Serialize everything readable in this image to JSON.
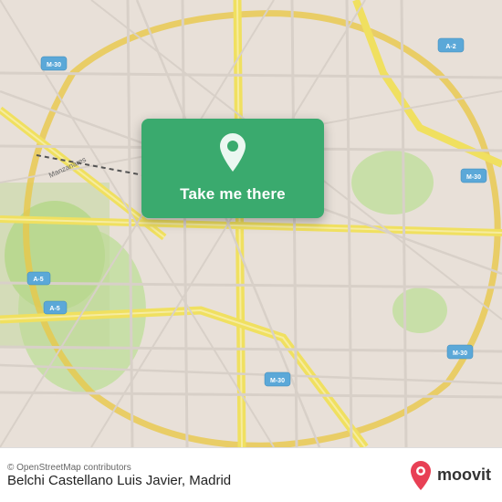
{
  "map": {
    "provider": "OpenStreetMap",
    "copyright": "© OpenStreetMap contributors"
  },
  "card": {
    "button_label": "Take me there"
  },
  "bottom_bar": {
    "location": "Belchi Castellano Luis Javier, Madrid",
    "moovit_label": "moovit"
  },
  "badges": {
    "m30_labels": [
      "M-30",
      "M-30",
      "M-30",
      "M-30"
    ],
    "a5_labels": [
      "A-5",
      "A-5"
    ],
    "a2_label": "A-2",
    "m30_color": "#6db8e8"
  }
}
